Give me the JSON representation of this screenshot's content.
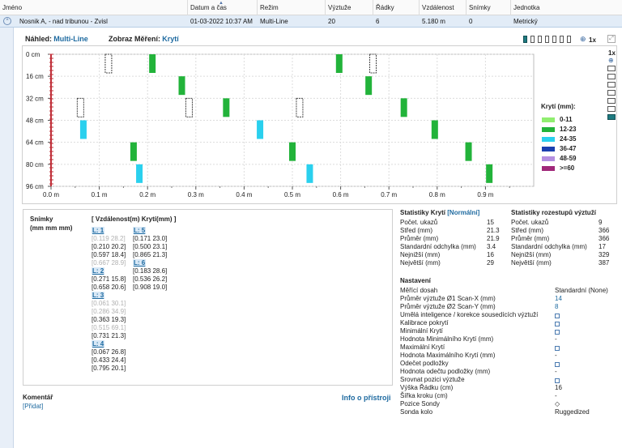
{
  "header": {
    "columns": [
      "Jméno",
      "Datum a čas",
      "Režim",
      "Výztuže",
      "Řádky",
      "Vzdálenost",
      "Snímky",
      "Jednotka"
    ]
  },
  "row": {
    "name": "Nosnik A, - nad tribunou - Zvisl",
    "datetime": "01-03-2022 10:37 AM",
    "mode": "Multi-Line",
    "rebars": "20",
    "lines": "6",
    "distance": "5.180 m",
    "snapshots": "0",
    "unit": "Metrický"
  },
  "preview": {
    "view_label": "Náhled:",
    "view_value": "Multi-Line",
    "display_label": "Zobraz Měření:",
    "display_value": "Krytí",
    "zoom": "1x",
    "side_zoom": "1x"
  },
  "legend": {
    "title": "Krytí (mm):",
    "items": [
      {
        "label": "0-11",
        "color": "#90ee70"
      },
      {
        "label": "12-23",
        "color": "#22b33a"
      },
      {
        "label": "24-35",
        "color": "#2ad0ee"
      },
      {
        "label": "36-47",
        "color": "#1a3fb0"
      },
      {
        "label": "48-59",
        "color": "#b48ee0"
      },
      {
        "label": ">=60",
        "color": "#a0287a"
      }
    ]
  },
  "chart_data": {
    "type": "scatter",
    "x_unit": "m",
    "y_unit": "cm",
    "x_ticks": [
      "0.0 m",
      "0.1 m",
      "0.2 m",
      "0.3 m",
      "0.4 m",
      "0.5 m",
      "0.6 m",
      "0.7 m",
      "0.8 m",
      "0.9 m"
    ],
    "y_ticks": [
      "0 cm",
      "16 cm",
      "32 cm",
      "48 cm",
      "64 cm",
      "80 cm",
      "96 cm"
    ],
    "xlim": [
      0,
      1.0
    ],
    "ylim": [
      0,
      96
    ],
    "markers": [
      {
        "line": 1,
        "x": 0.119,
        "cover": 28.2,
        "missing": true
      },
      {
        "line": 1,
        "x": 0.21,
        "cover": 20.2
      },
      {
        "line": 1,
        "x": 0.597,
        "cover": 18.4
      },
      {
        "line": 1,
        "x": 0.667,
        "cover": 28.9,
        "missing": true
      },
      {
        "line": 2,
        "x": 0.271,
        "cover": 15.8
      },
      {
        "line": 2,
        "x": 0.658,
        "cover": 20.6
      },
      {
        "line": 3,
        "x": 0.061,
        "cover": 30.1,
        "missing": true
      },
      {
        "line": 3,
        "x": 0.286,
        "cover": 34.9,
        "missing": true
      },
      {
        "line": 3,
        "x": 0.363,
        "cover": 19.3
      },
      {
        "line": 3,
        "x": 0.515,
        "cover": 69.1,
        "missing": true
      },
      {
        "line": 3,
        "x": 0.731,
        "cover": 21.3
      },
      {
        "line": 4,
        "x": 0.067,
        "cover": 26.8
      },
      {
        "line": 4,
        "x": 0.433,
        "cover": 24.4
      },
      {
        "line": 4,
        "x": 0.795,
        "cover": 20.1
      },
      {
        "line": 5,
        "x": 0.171,
        "cover": 23.0
      },
      {
        "line": 5,
        "x": 0.5,
        "cover": 23.1
      },
      {
        "line": 5,
        "x": 0.865,
        "cover": 21.3
      },
      {
        "line": 6,
        "x": 0.183,
        "cover": 28.6
      },
      {
        "line": 6,
        "x": 0.536,
        "cover": 26.2
      },
      {
        "line": 6,
        "x": 0.908,
        "cover": 19.0
      }
    ]
  },
  "readings": {
    "title": "Snímky",
    "units": "(mm  mm  mm)",
    "col_header": "[ Vzdálenost(m)  Krytí(mm) ]",
    "col1": [
      {
        "label": "L: 1"
      },
      {
        "text": "[0.119  28.2]",
        "missing": true
      },
      {
        "text": "[0.210  20.2]"
      },
      {
        "text": "[0.597  18.4]"
      },
      {
        "text": "[0.667  28.9]",
        "missing": true
      },
      {
        "label": "L: 2"
      },
      {
        "text": "[0.271  15.8]"
      },
      {
        "text": "[0.658  20.6]"
      },
      {
        "label": "L: 3"
      },
      {
        "text": "[0.061  30.1]",
        "missing": true
      },
      {
        "text": "[0.286  34.9]",
        "missing": true
      },
      {
        "text": "[0.363  19.3]"
      },
      {
        "text": "[0.515  69.1]",
        "missing": true
      },
      {
        "text": "[0.731  21.3]"
      },
      {
        "label": "L: 4"
      },
      {
        "text": "[0.067  26.8]"
      },
      {
        "text": "[0.433  24.4]"
      },
      {
        "text": "[0.795  20.1]"
      }
    ],
    "col2": [
      {
        "label": "L: 5"
      },
      {
        "text": "[0.171  23.0]"
      },
      {
        "text": "[0.500  23.1]"
      },
      {
        "text": "[0.865  21.3]"
      },
      {
        "label": "L: 6"
      },
      {
        "text": "[0.183  28.6]"
      },
      {
        "text": "[0.536  26.2]"
      },
      {
        "text": "[0.908  19.0]"
      }
    ]
  },
  "comment": {
    "title": "Komentář",
    "add_link": "[Přidat]",
    "info_link": "Info o přístroji"
  },
  "cover_stats": {
    "title": "Statistiky Krytí",
    "mode": "[Normální]",
    "rows": [
      {
        "k": "Počet. ukazů",
        "v": "15"
      },
      {
        "k": "Střed (mm)",
        "v": "21.3"
      },
      {
        "k": "Průměr (mm)",
        "v": "21.9"
      },
      {
        "k": "Standardní odchylka (mm)",
        "v": "3.4"
      },
      {
        "k": "Nejnižší (mm)",
        "v": "16"
      },
      {
        "k": "Největší (mm)",
        "v": "29"
      }
    ]
  },
  "spacing_stats": {
    "title": "Statistiky rozestupů výztuží",
    "rows": [
      {
        "k": "Počet. ukazů",
        "v": "9"
      },
      {
        "k": "Střed (mm)",
        "v": "366"
      },
      {
        "k": "Průměr (mm)",
        "v": "366"
      },
      {
        "k": "Standardní odchylka (mm)",
        "v": "17"
      },
      {
        "k": "Nejnižší (mm)",
        "v": "329"
      },
      {
        "k": "Největší (mm)",
        "v": "387"
      }
    ]
  },
  "settings": {
    "title": "Nastavení",
    "rows": [
      {
        "k": "Měřící dosah",
        "v": "Standardní (None)"
      },
      {
        "k": "Průměr výztuže Ø1 Scan-X (mm)",
        "v": "14",
        "blue": true
      },
      {
        "k": "Průměr výztuže Ø2 Scan-Y (mm)",
        "v": "8",
        "blue": true
      },
      {
        "k": "Umělá inteligence / korekce sousedících výztuží",
        "v": "",
        "checkbox": true
      },
      {
        "k": "Kalibrace pokrytí",
        "v": "",
        "checkbox": true
      },
      {
        "k": "Minimální Krytí",
        "v": "",
        "checkbox": true
      },
      {
        "k": "   Hodnota Minimálního Krytí (mm)",
        "v": "-"
      },
      {
        "k": "Maximální Krytí",
        "v": "",
        "checkbox": true
      },
      {
        "k": "   Hodnota Maximálního Krytí (mm)",
        "v": "-"
      },
      {
        "k": "Odečet podložky",
        "v": "",
        "checkbox": true
      },
      {
        "k": "   Hodnota  odečtu podložky (mm)",
        "v": "-"
      },
      {
        "k": "Srovnat pozici výztuže",
        "v": "",
        "checkbox": true
      },
      {
        "k": "Výška Řádku (cm)",
        "v": "16"
      },
      {
        "k": "Šířka kroku (cm)",
        "v": "-"
      },
      {
        "k": "Pozice Sondy",
        "v": "◇"
      },
      {
        "k": "Sonda kolo",
        "v": "Ruggedized"
      }
    ]
  }
}
